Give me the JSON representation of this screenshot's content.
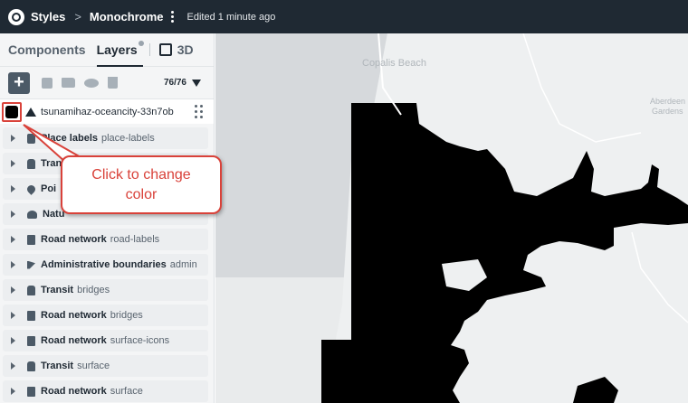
{
  "topbar": {
    "crumb_styles": "Styles",
    "crumb_separator": ">",
    "crumb_style_name": "Monochrome",
    "edited_status": "Edited 1 minute ago"
  },
  "sidebar": {
    "tab_components": "Components",
    "tab_layers": "Layers",
    "tab_3d": "3D",
    "layer_count": "76/76",
    "active_layer": {
      "name": "tsunamihaz-oceancity-33n7ob",
      "swatch_color": "#000000"
    },
    "groups": [
      {
        "name": "P",
        "hidden_part": "lace labels",
        "sub": "place-labels",
        "icon": "people-icon"
      },
      {
        "name": "Trans",
        "sub": "",
        "icon": "bus-icon"
      },
      {
        "name": "Poi",
        "sub": "",
        "icon": "pin-icon"
      },
      {
        "name": "Natu",
        "sub": "",
        "icon": "tree-icon"
      },
      {
        "name": "Road network",
        "sub": "road-labels",
        "icon": "lock-icon"
      },
      {
        "name": "Administrative boundaries",
        "sub": "admin",
        "icon": "flag-icon"
      },
      {
        "name": "Transit",
        "sub": "bridges",
        "icon": "bus-icon"
      },
      {
        "name": "Road network",
        "sub": "bridges",
        "icon": "lock-icon"
      },
      {
        "name": "Road network",
        "sub": "surface-icons",
        "icon": "lock-icon"
      },
      {
        "name": "Transit",
        "sub": "surface",
        "icon": "bus-icon"
      },
      {
        "name": "Road network",
        "sub": "surface",
        "icon": "lock-icon"
      }
    ]
  },
  "map": {
    "labels": [
      "Copalis Beach",
      "Aberdeen",
      "Gardens"
    ]
  },
  "callout": {
    "line1": "Click to change",
    "line2": "color"
  },
  "colors": {
    "accent_red": "#d9423a",
    "topbar": "#1f2933",
    "map_bg": "#e9ebec"
  }
}
